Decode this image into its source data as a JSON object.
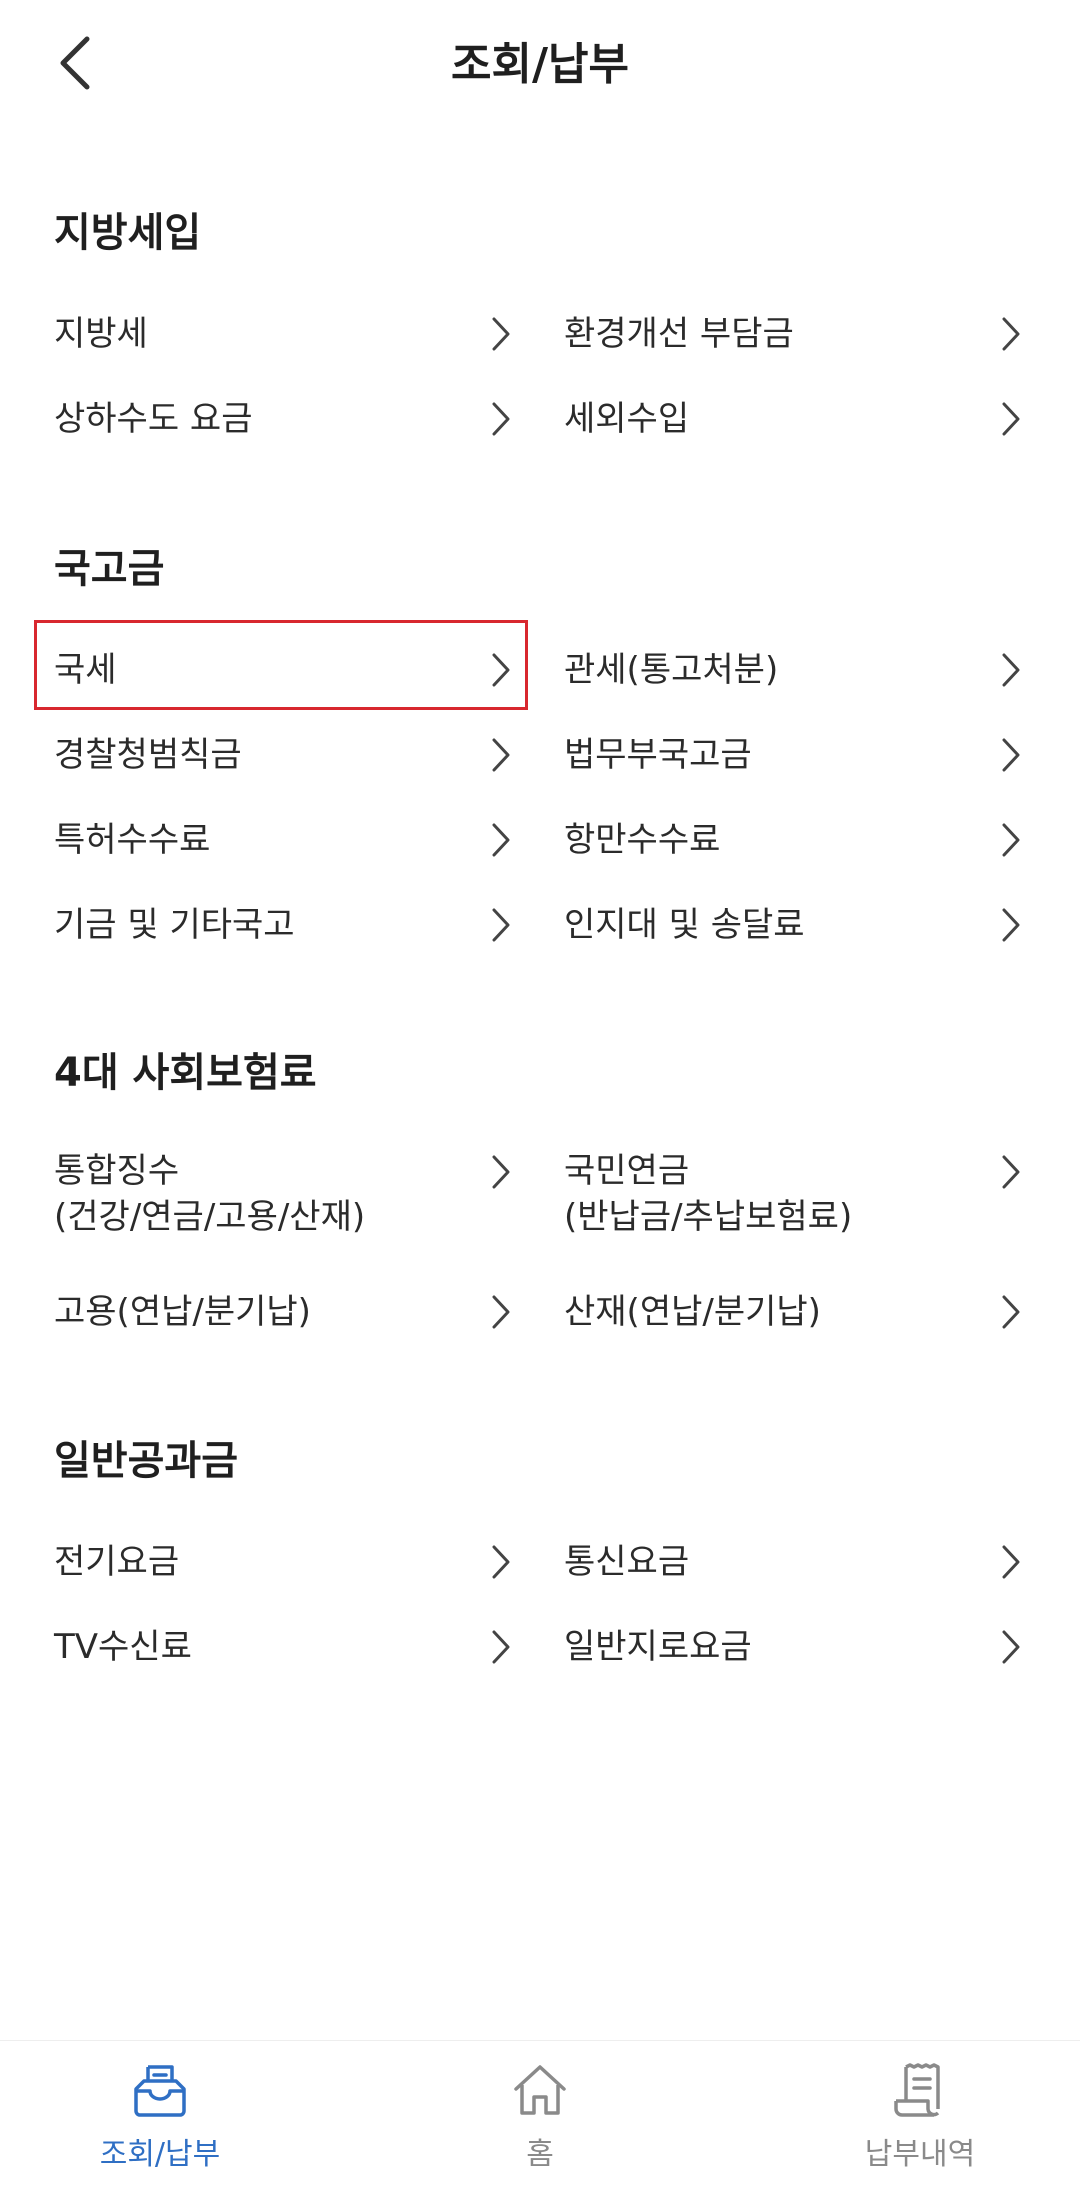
{
  "header": {
    "title": "조회/납부"
  },
  "sections": [
    {
      "title": "지방세입",
      "items": [
        {
          "label": "지방세"
        },
        {
          "label": "환경개선 부담금"
        },
        {
          "label": "상하수도 요금"
        },
        {
          "label": "세외수입"
        }
      ]
    },
    {
      "title": "국고금",
      "items": [
        {
          "label": "국세"
        },
        {
          "label": "관세(통고처분)"
        },
        {
          "label": "경찰청범칙금"
        },
        {
          "label": "법무부국고금"
        },
        {
          "label": "특허수수료"
        },
        {
          "label": "항만수수료"
        },
        {
          "label": "기금 및 기타국고"
        },
        {
          "label": "인지대 및 송달료"
        }
      ]
    },
    {
      "title": "4대 사회보험료",
      "items": [
        {
          "label": "통합징수\n(건강/연금/고용/산재)"
        },
        {
          "label": "국민연금\n(반납금/추납보험료)"
        },
        {
          "label": "고용(연납/분기납)"
        },
        {
          "label": "산재(연납/분기납)"
        }
      ]
    },
    {
      "title": "일반공과금",
      "items": [
        {
          "label": "전기요금"
        },
        {
          "label": "통신요금"
        },
        {
          "label": "TV수신료"
        },
        {
          "label": "일반지로요금"
        }
      ]
    }
  ],
  "tabbar": {
    "active_color": "#2f6fc4",
    "inactive_color": "#8a8a8a",
    "tabs": [
      {
        "label": "조회/납부",
        "icon": "inbox-icon",
        "active": true
      },
      {
        "label": "홈",
        "icon": "home-icon",
        "active": false
      },
      {
        "label": "납부내역",
        "icon": "receipt-icon",
        "active": false
      }
    ]
  },
  "highlight_color": "#d8282f"
}
